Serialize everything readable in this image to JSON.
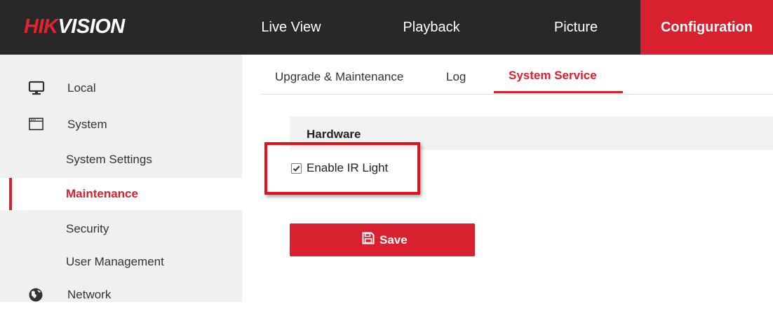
{
  "brand": {
    "logo_red": "HIK",
    "logo_white": "VISION",
    "red": "#e4232d"
  },
  "top_nav": {
    "items": [
      {
        "label": "Live View"
      },
      {
        "label": "Playback"
      },
      {
        "label": "Picture"
      },
      {
        "label": "Configuration",
        "active": true
      }
    ]
  },
  "sidebar": {
    "items": [
      {
        "label": "Local",
        "icon": "monitor-icon"
      },
      {
        "label": "System",
        "icon": "window-icon"
      },
      {
        "label": "System Settings"
      },
      {
        "label": "Maintenance",
        "active": true
      },
      {
        "label": "Security"
      },
      {
        "label": "User Management"
      },
      {
        "label": "Network",
        "icon": "globe-icon"
      }
    ]
  },
  "tabs": [
    {
      "label": "Upgrade & Maintenance"
    },
    {
      "label": "Log"
    },
    {
      "label": "System Service",
      "active": true
    }
  ],
  "section": {
    "title": "Hardware"
  },
  "options": {
    "ir_light_label": "Enable IR Light",
    "ir_light_checked": true
  },
  "actions": {
    "save_label": "Save",
    "save_icon": "floppy-disk-icon"
  },
  "colors": {
    "accent": "#d8202e",
    "topbar": "#282828",
    "sidebar": "#f0f0f0"
  }
}
